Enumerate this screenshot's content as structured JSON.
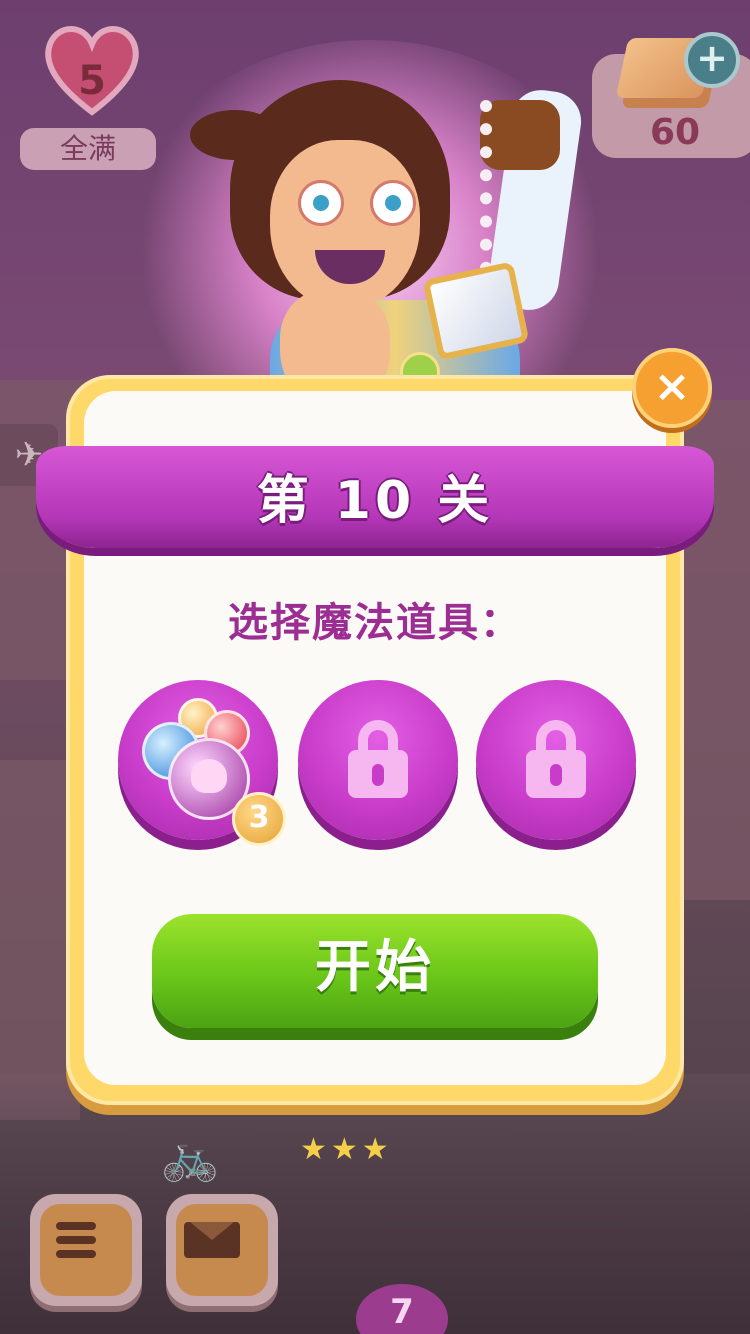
{
  "hud": {
    "lives": {
      "count": "5",
      "status": "全满"
    },
    "gold": {
      "amount": "60"
    }
  },
  "dialog": {
    "level_title": "第 10 关",
    "subtitle": "选择魔法道具：",
    "boosters": [
      {
        "name": "bubble-booster",
        "count": "3",
        "locked": false
      },
      {
        "name": "locked-booster-2",
        "locked": true
      },
      {
        "name": "locked-booster-3",
        "locked": true
      }
    ],
    "start_label": "开始",
    "close_symbol": "×"
  },
  "map": {
    "next_level": "7"
  },
  "colors": {
    "dialog_border": "#ffd86a",
    "banner": "#c43fc6",
    "start_button": "#6ac619",
    "booster": "#c83cc9"
  }
}
